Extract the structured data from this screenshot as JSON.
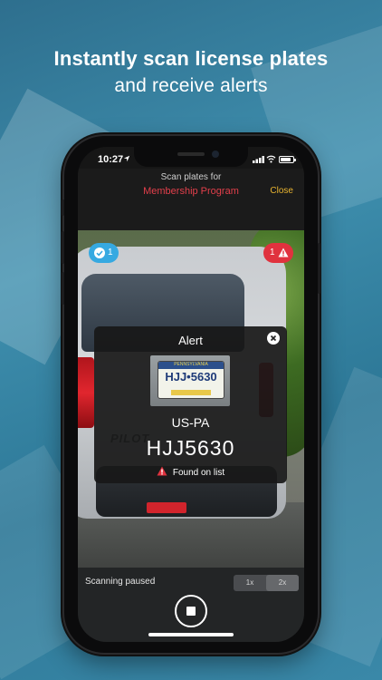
{
  "promo": {
    "headline": "Instantly scan license plates",
    "subline": "and receive alerts"
  },
  "status_bar": {
    "time": "10:27",
    "icons": [
      "location-arrow-icon",
      "signal-bars-icon",
      "wifi-icon",
      "battery-icon"
    ]
  },
  "header": {
    "scan_for_label": "Scan plates for",
    "program_name": "Membership Program",
    "close_label": "Close"
  },
  "badges": {
    "confirmed_count": "1",
    "alert_count": "1"
  },
  "alert": {
    "title": "Alert",
    "region": "US-PA",
    "plate_number": "HJJ5630",
    "status": "Found on list"
  },
  "plate_photo": {
    "state_banner": "PENNSYLVANIA",
    "number": "HJJ•5630"
  },
  "bottom_panel": {
    "status_text": "Scanning paused",
    "zoom_options": [
      "1x",
      "2x"
    ],
    "selected_zoom": "2x"
  },
  "colors": {
    "accent_red": "#e33f4b",
    "close_yellow": "#e8b430",
    "confirm_blue": "#36a9e1",
    "alert_red": "#e0323e"
  }
}
